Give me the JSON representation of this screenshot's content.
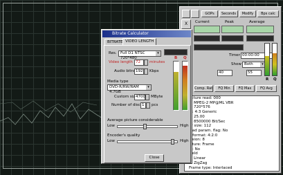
{
  "stats_window": {
    "toolbar_buttons": [
      "GOPs",
      "Seconds",
      "Modify",
      "Bps calc"
    ],
    "close_glyph": "X",
    "headers": [
      "Current",
      "Peak",
      "Average"
    ],
    "timer_label": "Timer",
    "timer_value": "00:00:00",
    "show_label": "Show",
    "show_value": "Both",
    "field1": "40",
    "field2": "55",
    "rq_labels": [
      "R",
      "Q"
    ],
    "tab_buttons": [
      "Comp. Ratio",
      "FQ Min",
      "FQ Max",
      "FQ Avg"
    ],
    "info_lines": [
      "ucture read: 000",
      "e: MPEG-2  MP@ML  VBR",
      "e: 720*576",
      "io: 4:3 Generic",
      "e: 25.00",
      "e: 8500000 Bit/Sec",
      "er size: 112",
      "load param. flag: No",
      "e format: 4:2:0",
      "cision: 8",
      "icture: Frame",
      "st: No",
      "Field",
      "e: Linear",
      "e: ZigZag",
      "Frame type: Interlaced"
    ]
  },
  "calculator": {
    "title": "Bitrate Calculator",
    "tabs": [
      "BITRATE",
      "VIDEO LENGTH"
    ],
    "res_label": "Res.",
    "res_value": "Full D1 NTSC 720*480",
    "video_length_label": "Video length",
    "video_length_value": "72",
    "minutes_label": "minutes",
    "audio_label": "Audio bitrate",
    "audio_value": "192",
    "kbps_label": "Kbps",
    "media_label": "Media type",
    "media_value": "DVD-R/RW/RAM 4.7GB",
    "custom_label": "Custom size",
    "custom_value": "4700",
    "mbyte_label": "MByte",
    "discs_label": "Number of discs",
    "discs_value": "1",
    "pcs_label": "pcs",
    "apc_label": "Average picture considerable",
    "low1": "Low",
    "high1": "High",
    "enc_label": "Encoder's quality",
    "low2": "Low",
    "high2": "High",
    "close_label": "Close",
    "bar_labels": [
      "B",
      "Q"
    ],
    "bar_levels": [
      0.78,
      0.92
    ]
  }
}
